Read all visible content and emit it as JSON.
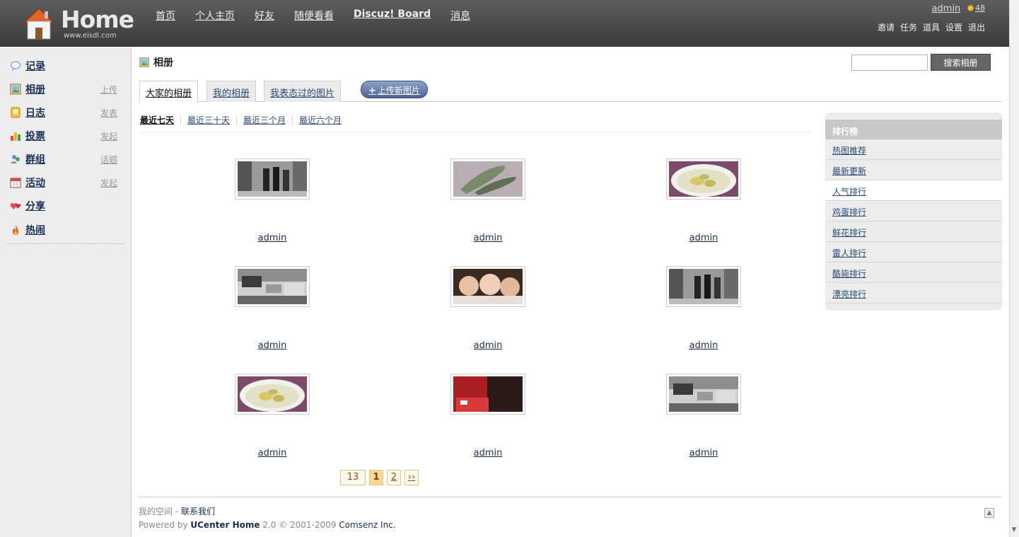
{
  "header": {
    "logo_text": "Home",
    "logo_url": "www.eisdl.com",
    "nav": [
      "首页",
      "个人主页",
      "好友",
      "随便看看",
      "Discuz! Board",
      "消息"
    ],
    "username": "admin",
    "credits": "48",
    "user_links": [
      "邀请",
      "任务",
      "道具",
      "设置",
      "退出"
    ]
  },
  "sidebar": {
    "items": [
      {
        "label": "记录",
        "action": "",
        "icon": "speech-bubble-icon"
      },
      {
        "label": "相册",
        "action": "上传",
        "icon": "photo-icon"
      },
      {
        "label": "日志",
        "action": "发表",
        "icon": "notebook-icon"
      },
      {
        "label": "投票",
        "action": "发起",
        "icon": "bar-chart-icon"
      },
      {
        "label": "群组",
        "action": "话题",
        "icon": "people-icon"
      },
      {
        "label": "活动",
        "action": "发起",
        "icon": "calendar-icon"
      },
      {
        "label": "分享",
        "action": "",
        "icon": "hearts-icon"
      },
      {
        "label": "热闹",
        "action": "",
        "icon": "fire-icon"
      }
    ]
  },
  "main": {
    "title": "相册",
    "search_button": "搜索相册",
    "tabs": [
      "大家的相册",
      "我的相册",
      "我表态过的图片"
    ],
    "upload_button": "上传新图片",
    "time_filters": [
      "最近七天",
      "最近三十天",
      "最近三个月",
      "最近六个月"
    ],
    "photos": [
      {
        "owner": "admin",
        "scene": "street-bw"
      },
      {
        "owner": "admin",
        "scene": "shoes"
      },
      {
        "owner": "admin",
        "scene": "soup"
      },
      {
        "owner": "admin",
        "scene": "traffic"
      },
      {
        "owner": "admin",
        "scene": "girls"
      },
      {
        "owner": "admin",
        "scene": "street-bw"
      },
      {
        "owner": "admin",
        "scene": "soup"
      },
      {
        "owner": "admin",
        "scene": "red-room"
      },
      {
        "owner": "admin",
        "scene": "traffic"
      }
    ],
    "pager": {
      "total": "13",
      "current": "1",
      "next_page": "2",
      "next": "››"
    }
  },
  "ranking": {
    "title": "排行榜",
    "items": [
      "热图推荐",
      "最新更新",
      "人气排行",
      "鸡蛋排行",
      "鲜花排行",
      "雷人排行",
      "酷毙排行",
      "漂亮排行"
    ],
    "selected_index": 2
  },
  "footer": {
    "line1_prefix": "我的空间",
    "line1_sep": " - ",
    "contact": "联系我们",
    "powered_by": "Powered by ",
    "product": "UCenter Home",
    "version": " 2.0 © 2001-2009 ",
    "company": "Comsenz Inc."
  }
}
